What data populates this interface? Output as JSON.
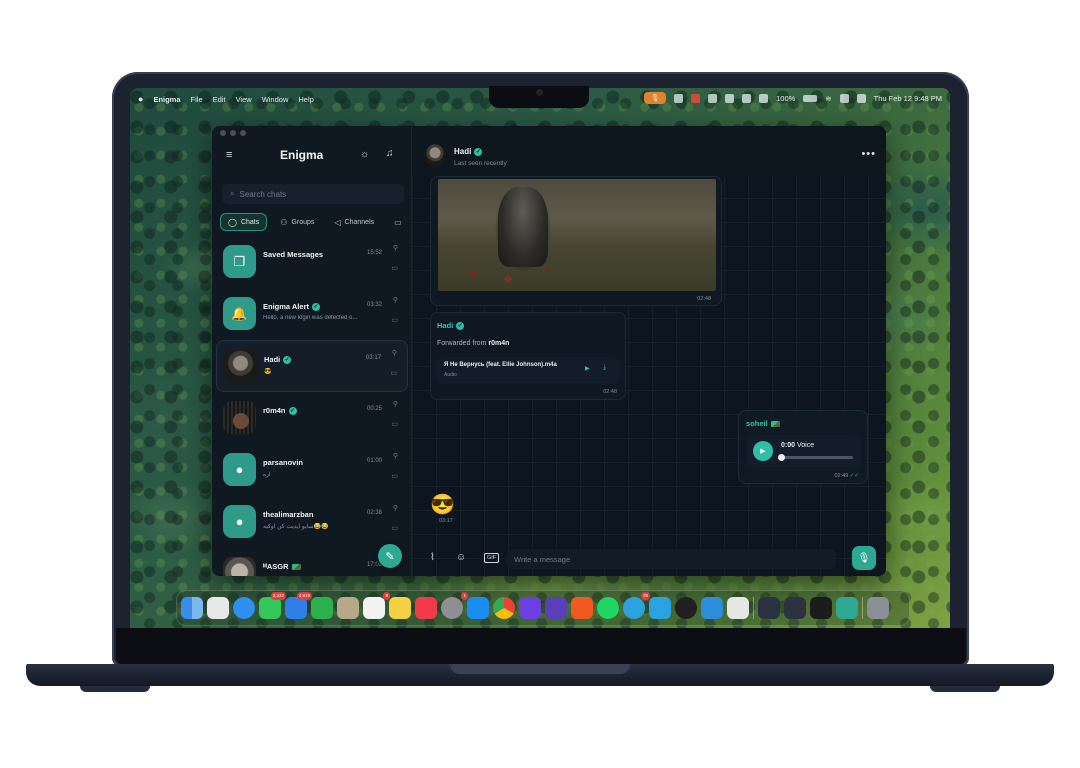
{
  "menubar": {
    "apple": "",
    "app_name": "Enigma",
    "menus": [
      "File",
      "Edit",
      "View",
      "Window",
      "Help"
    ],
    "battery": "100%",
    "datetime": "Thu Feb 12  9:48 PM"
  },
  "sidebar": {
    "title": "Enigma",
    "search_placeholder": "Search chats",
    "tabs": [
      {
        "label": "Chats",
        "icon": "chat-bubble-icon"
      },
      {
        "label": "Groups",
        "icon": "users-icon"
      },
      {
        "label": "Channels",
        "icon": "megaphone-icon"
      }
    ],
    "chats": [
      {
        "name": "Saved Messages",
        "preview": "",
        "time": "15:52",
        "avatar": "bookmark-icon",
        "verified": false
      },
      {
        "name": "Enigma Alert",
        "preview": "Hello, a new login was detected o...",
        "time": "03:32",
        "avatar": "bell-icon",
        "verified": true
      },
      {
        "name": "Hadi",
        "preview": "😎",
        "time": "03:17",
        "avatar": "photo",
        "verified": true
      },
      {
        "name": "r0m4n",
        "preview": "",
        "time": "00:25",
        "avatar": "photo",
        "verified": true
      },
      {
        "name": "parsanovin",
        "preview": "اره",
        "time": "01:00",
        "avatar": "user-icon",
        "verified": false
      },
      {
        "name": "thealimarzban",
        "preview": "سایو اپدیت کن اوکیه😂😂",
        "time": "02:38",
        "avatar": "user-icon",
        "verified": false
      },
      {
        "name": "ᴹASGR",
        "preview": "",
        "time": "17:02",
        "avatar": "photo",
        "verified": false
      }
    ]
  },
  "chat": {
    "name": "Hadi",
    "status": "Last seen recently",
    "messages": {
      "image_time": "02:48",
      "forward_sender": "Hadi",
      "forward_prefix": "Forwarded from ",
      "forward_from": "r0m4n",
      "file_name": "Я Не Вернусь (feat. Ellie Johnson).m4a",
      "file_type": "Audio",
      "forward_time": "02:48",
      "voice_sender": "soheil",
      "voice_time_label": "0:00",
      "voice_label": "Voice",
      "voice_progress": 0,
      "voice_time": "02:49",
      "emoji": "😎",
      "emoji_time": "03:17"
    },
    "composer_placeholder": "Write a message"
  },
  "dock": {
    "badges": {
      "messages": "3,222",
      "mail": "4,819",
      "calendar": "8",
      "chrome": "1",
      "telegram": "29"
    }
  },
  "colors": {
    "accent": "#2fbfa4",
    "window_bg": "#0d141e"
  }
}
